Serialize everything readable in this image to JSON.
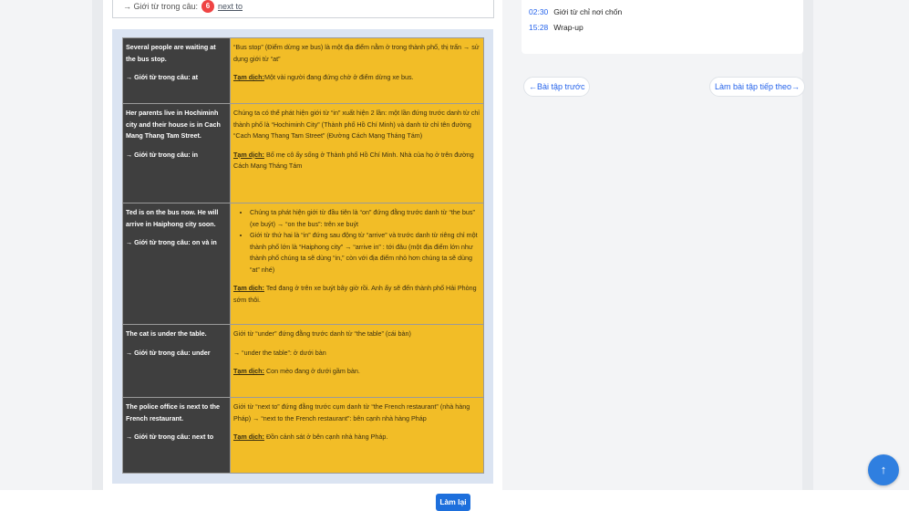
{
  "top": {
    "text": "→ Giới từ trong câu:",
    "badge": "6",
    "link": "next to"
  },
  "rows": [
    {
      "en": [
        "Several people are waiting at the bus stop.",
        "→ Giới từ trong câu: at"
      ],
      "vi": [
        "“Bus stop” (Điểm dừng xe bus) là một địa điểm nằm ở trong thành phố, thị trấn → sử dụng giới từ “at”"
      ],
      "td_label": "Tạm dịch:",
      "td_text": "Một vài người đang đứng chờ ở điểm dừng xe bus."
    },
    {
      "en": [
        "Her parents live in Hochiminh city and their house is in Cach Mang Thang Tam Street.",
        "→ Giới từ trong câu: in"
      ],
      "vi": [
        "Chúng ta có thể phát hiện giới từ “in” xuất hiện 2 lần: một lần đứng trước danh từ chỉ thành phố là “Hochiminh City” (Thành phố Hồ Chí Minh) và danh từ chỉ tên đường “Cach Mang Thang Tam Street” (Đường Cách Mạng Tháng Tám)"
      ],
      "td_label": "Tạm dịch:",
      "td_text": " Bố mẹ cô ấy sống ở Thành phố Hồ Chí Minh. Nhà của họ ở trên đường Cách Mạng Tháng Tám"
    },
    {
      "en": [
        "Ted is on the bus now. He will arrive in Haiphong city soon.",
        "→ Giới từ trong câu: on và in"
      ],
      "bullets": [
        "Chúng ta phát hiện giới từ đầu tiên là “on” đứng đằng trước danh từ “the bus” (xe buýt) → “on the bus”: trên xe buýt",
        "Giới từ thứ hai là “in” đứng sau động từ “arrive” và trước  danh từ riêng chỉ một thành phố lớn là “Haiphong city” → “arrive in” : tới đâu (một địa điểm lớn như thành phố chúng ta sẽ dùng “in,” còn với địa điểm nhỏ hơn chúng ta sẽ dùng “at” nhé)"
      ],
      "td_label": "Tạm dịch:",
      "td_text": " Ted đang ở trên xe buýt bây giờ rồi. Anh ấy sẽ đến thành phố Hải Phòng sớm thôi."
    },
    {
      "en": [
        "The cat is under the table.",
        "→ Giới từ trong câu: under"
      ],
      "vi": [
        "Giới từ “under” đứng đằng trước danh từ “the table” (cái bàn)",
        "→ “under the table”: ở dưới bàn"
      ],
      "td_label": "Tạm dịch:",
      "td_text": " Con mèo đang ở dưới gầm bàn."
    },
    {
      "en": [
        "The police office is next to the French restaurant.",
        "→ Giới từ trong câu: next to"
      ],
      "vi": [
        "Giới từ “next to” đứng đằng trước cụm danh từ “the French restaurant” (nhà hàng Pháp) → “next to the French restaurant”: bên cạnh nhà hàng Pháp"
      ],
      "td_label": "Tạm dịch:",
      "td_text": " Đồn cảnh sát ở bên cạnh nhà hàng Pháp."
    }
  ],
  "agenda": [
    {
      "time": "02:30",
      "label": "Giới từ chỉ nơi chốn"
    },
    {
      "time": "15:28",
      "label": "Wrap-up"
    }
  ],
  "nav": {
    "prev": "←Bài tập trước",
    "next": "Làm bài tập tiếp theo→"
  },
  "redo": "Làm lại",
  "scroll_top_icon": "↑",
  "colors": {
    "en_cell": "#3f3f3f",
    "vi_cell": "#f2bd27",
    "accent": "#1d6fdc"
  }
}
